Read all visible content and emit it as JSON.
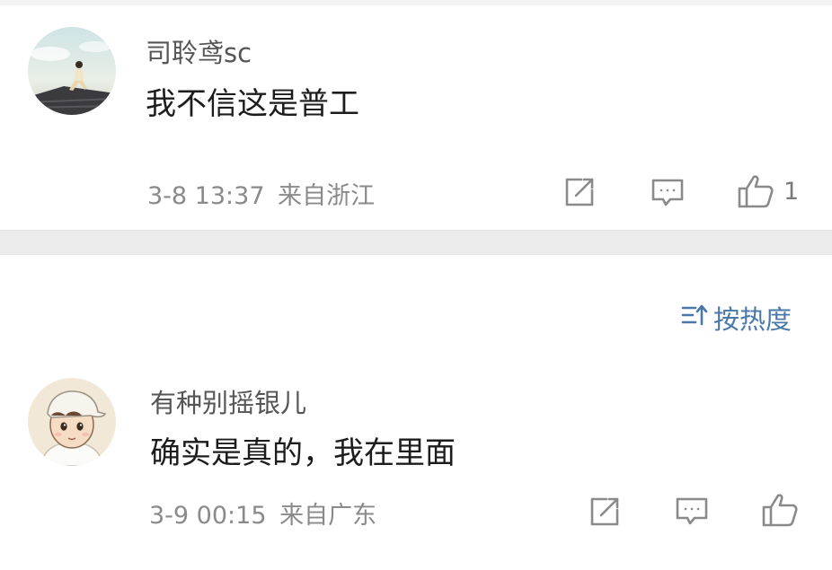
{
  "comments": [
    {
      "username": "司聆鸢sc",
      "text": "我不信这是普工",
      "time": "3-8 13:37",
      "location": "来自浙江",
      "like_count": "1"
    },
    {
      "username": "有种别摇银儿",
      "text": "确实是真的，我在里面",
      "time": "3-9 00:15",
      "location": "来自广东",
      "like_count": ""
    }
  ],
  "sort": {
    "label": "按热度"
  },
  "icons": {
    "share": "share-icon",
    "comment": "comment-icon",
    "like": "thumbs-up-icon",
    "sort": "sort-icon"
  },
  "colors": {
    "link": "#4a78a8",
    "meta": "#8a8a8a",
    "text": "#1c1c1c"
  }
}
